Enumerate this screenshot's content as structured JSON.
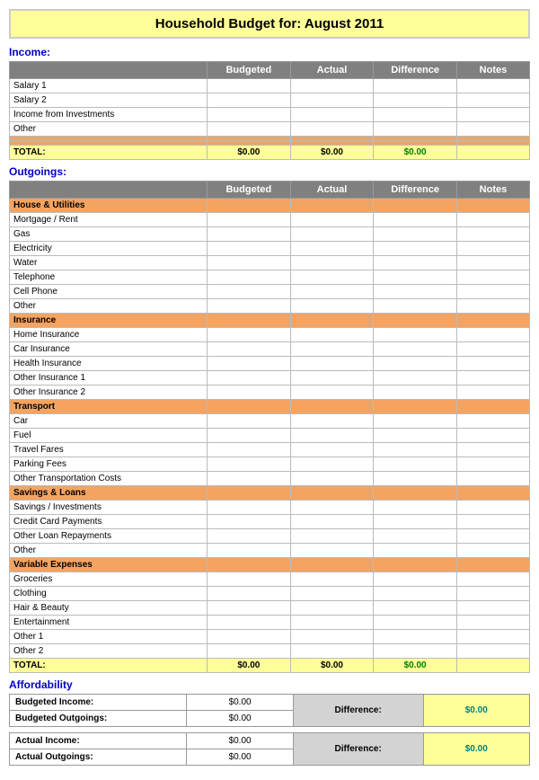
{
  "title": {
    "prefix": "Household Budget for:",
    "month": "August 2011",
    "full": "Household Budget for:   August 2011"
  },
  "income": {
    "label": "Income:",
    "headers": [
      "",
      "Budgeted",
      "Actual",
      "Difference",
      "Notes"
    ],
    "rows": [
      {
        "label": "Salary 1",
        "type": "white"
      },
      {
        "label": "Salary 2",
        "type": "white"
      },
      {
        "label": "Income from Investments",
        "type": "white"
      },
      {
        "label": "Other",
        "type": "white"
      },
      {
        "label": "",
        "type": "orange-empty"
      },
      {
        "label": "",
        "type": "orange-empty"
      }
    ],
    "total": {
      "label": "TOTAL:",
      "budgeted": "$0.00",
      "actual": "$0.00",
      "diff": "$0.00"
    }
  },
  "outgoings": {
    "label": "Outgoings:",
    "headers": [
      "",
      "Budgeted",
      "Actual",
      "Difference",
      "Notes"
    ],
    "groups": [
      {
        "header": "House & Utilities",
        "rows": [
          "Mortgage / Rent",
          "Gas",
          "Electricity",
          "Water",
          "Telephone",
          "Cell Phone",
          "Other"
        ]
      },
      {
        "header": "Insurance",
        "rows": [
          "Home Insurance",
          "Car Insurance",
          "Health Insurance",
          "Other Insurance 1",
          "Other Insurance 2"
        ]
      },
      {
        "header": "Transport",
        "rows": [
          "Car",
          "Fuel",
          "Travel Fares",
          "Parking Fees",
          "Other Transportation Costs"
        ]
      },
      {
        "header": "Savings & Loans",
        "rows": [
          "Savings / Investments",
          "Credit Card Payments",
          "Other Loan Repayments",
          "Other"
        ]
      },
      {
        "header": "Variable Expenses",
        "rows": [
          "Groceries",
          "Clothing",
          "Hair & Beauty",
          "Entertainment",
          "Other 1",
          "Other 2"
        ]
      }
    ],
    "total": {
      "label": "TOTAL:",
      "budgeted": "$0.00",
      "actual": "$0.00",
      "diff": "$0.00"
    }
  },
  "affordability": {
    "label": "Affordability",
    "budgeted_income_label": "Budgeted Income:",
    "budgeted_income_val": "$0.00",
    "budgeted_outgoings_label": "Budgeted Outgoings:",
    "budgeted_outgoings_val": "$0.00",
    "budgeted_diff_label": "Difference:",
    "budgeted_diff_val": "$0.00",
    "actual_income_label": "Actual Income:",
    "actual_income_val": "$0.00",
    "actual_outgoings_label": "Actual Outgoings:",
    "actual_outgoings_val": "$0.00",
    "actual_diff_label": "Difference:",
    "actual_diff_val": "$0.00"
  }
}
